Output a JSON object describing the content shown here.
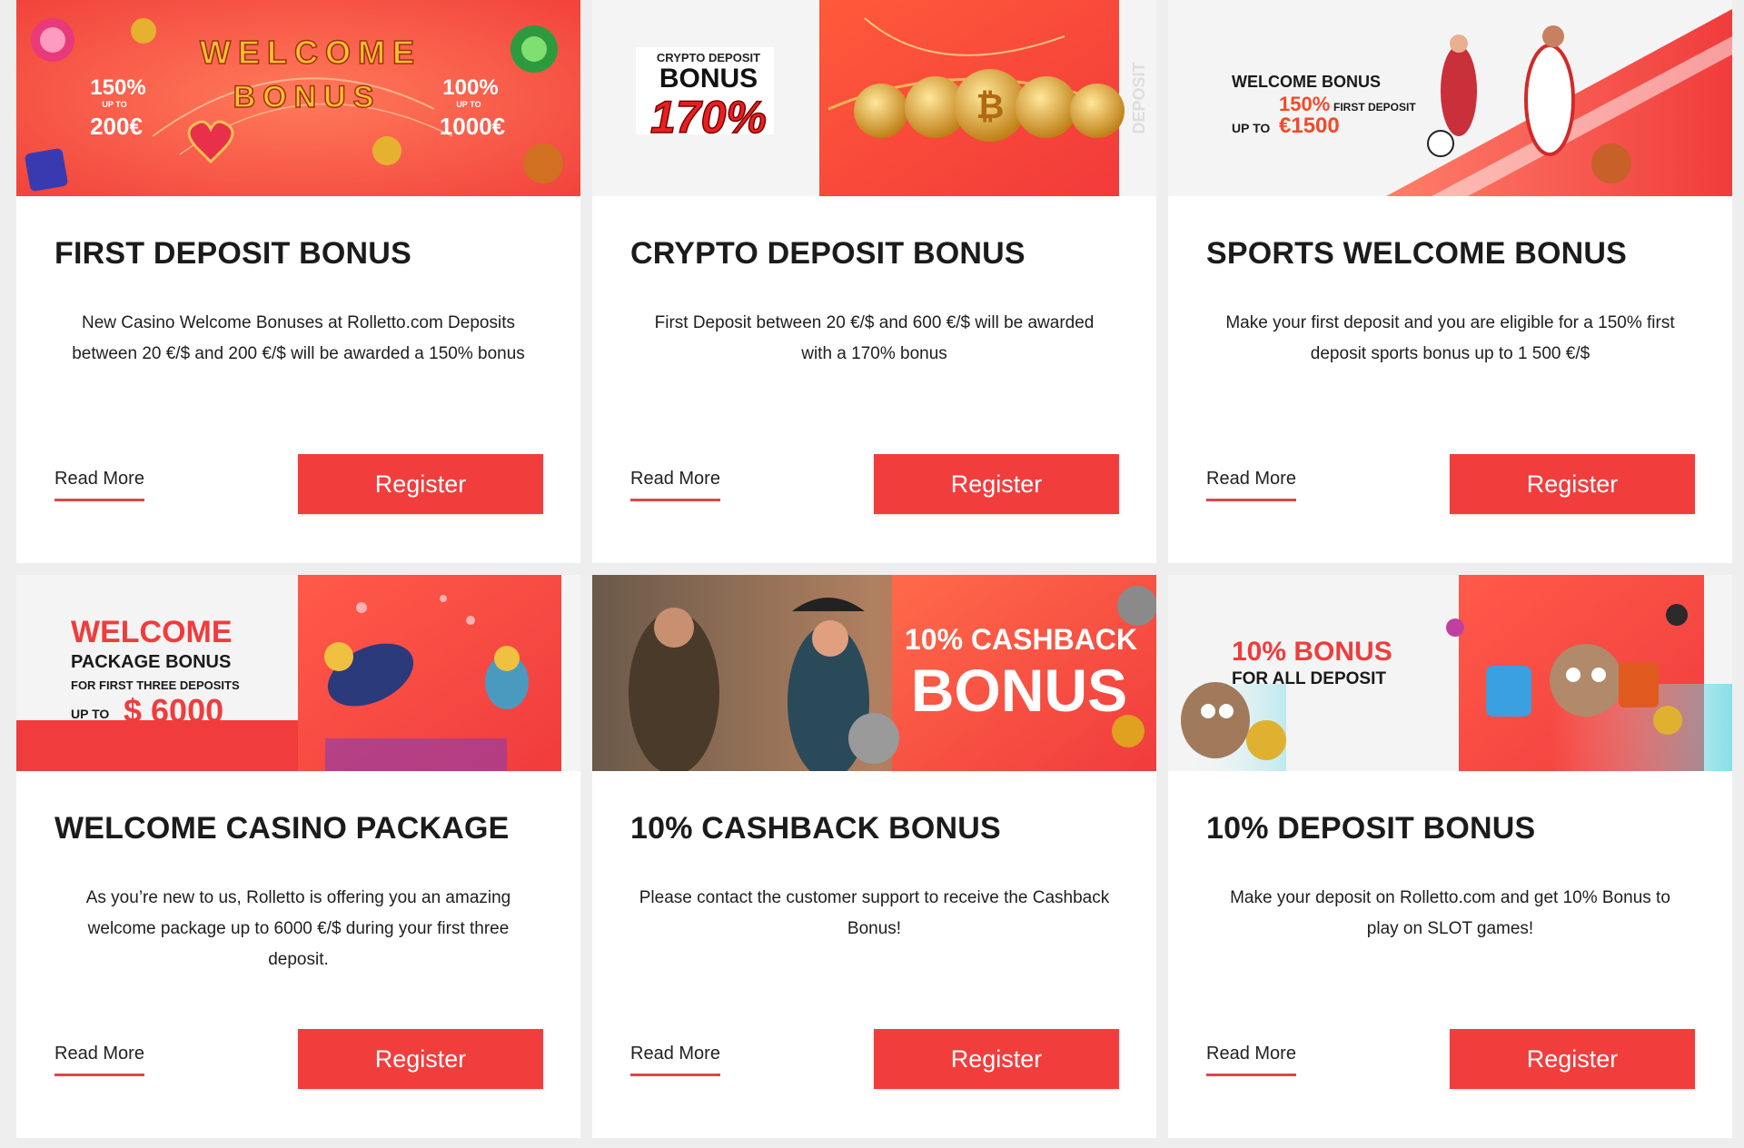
{
  "colors": {
    "accent": "#f23d3d",
    "background": "#eeeeee",
    "card": "#ffffff"
  },
  "cards": [
    {
      "title": "FIRST DEPOSIT BONUS",
      "description": "New Casino Welcome Bonuses at Rolletto.com Deposits between 20 €/$ and 200 €/$ will be awarded a 150% bonus",
      "read_more": "Read More",
      "register": "Register",
      "banner": {
        "line1": "WELCOME",
        "line2": "BONUS",
        "left_pct": "150%",
        "left_upto": "UP TO",
        "left_amount": "200€",
        "right_pct": "100%",
        "right_upto": "UP TO",
        "right_amount": "1000€"
      }
    },
    {
      "title": "CRYPTO DEPOSIT BONUS",
      "description": "First Deposit between 20 €/$ and 600 €/$ will be awarded with a 170% bonus",
      "read_more": "Read More",
      "register": "Register",
      "banner": {
        "line1": "CRYPTO DEPOSIT",
        "line2": "BONUS",
        "pct": "170%",
        "side": "DEPOSIT"
      }
    },
    {
      "title": "SPORTS WELCOME BONUS",
      "description": "Make your first deposit and you are eligible for a 150% first deposit sports bonus up to 1 500 €/$",
      "read_more": "Read More",
      "register": "Register",
      "banner": {
        "line1": "WELCOME BONUS",
        "pct": "150%",
        "first": "FIRST DEPOSIT",
        "upto": "UP TO",
        "amount": "€1500"
      }
    },
    {
      "title": "WELCOME CASINO PACKAGE",
      "description": "As you’re new to us, Rolletto is offering you an amazing welcome package up to 6000 €/$ during your first three deposit.",
      "read_more": "Read More",
      "register": "Register",
      "banner": {
        "line1": "WELCOME",
        "line2": "PACKAGE BONUS",
        "line3": "FOR FIRST THREE DEPOSITS",
        "upto": "UP TO",
        "amount": "$ 6000"
      }
    },
    {
      "title": "10% CASHBACK BONUS",
      "description": "Please contact the customer support to receive the Cashback Bonus!",
      "read_more": "Read More",
      "register": "Register",
      "banner": {
        "line1": "10% CASHBACK",
        "line2": "BONUS"
      }
    },
    {
      "title": "10% DEPOSIT BONUS",
      "description": "Make your deposit on Rolletto.com and get 10% Bonus to play on SLOT games!",
      "read_more": "Read More",
      "register": "Register",
      "banner": {
        "line1": "10% BONUS",
        "line2": "FOR ALL DEPOSIT"
      }
    }
  ]
}
